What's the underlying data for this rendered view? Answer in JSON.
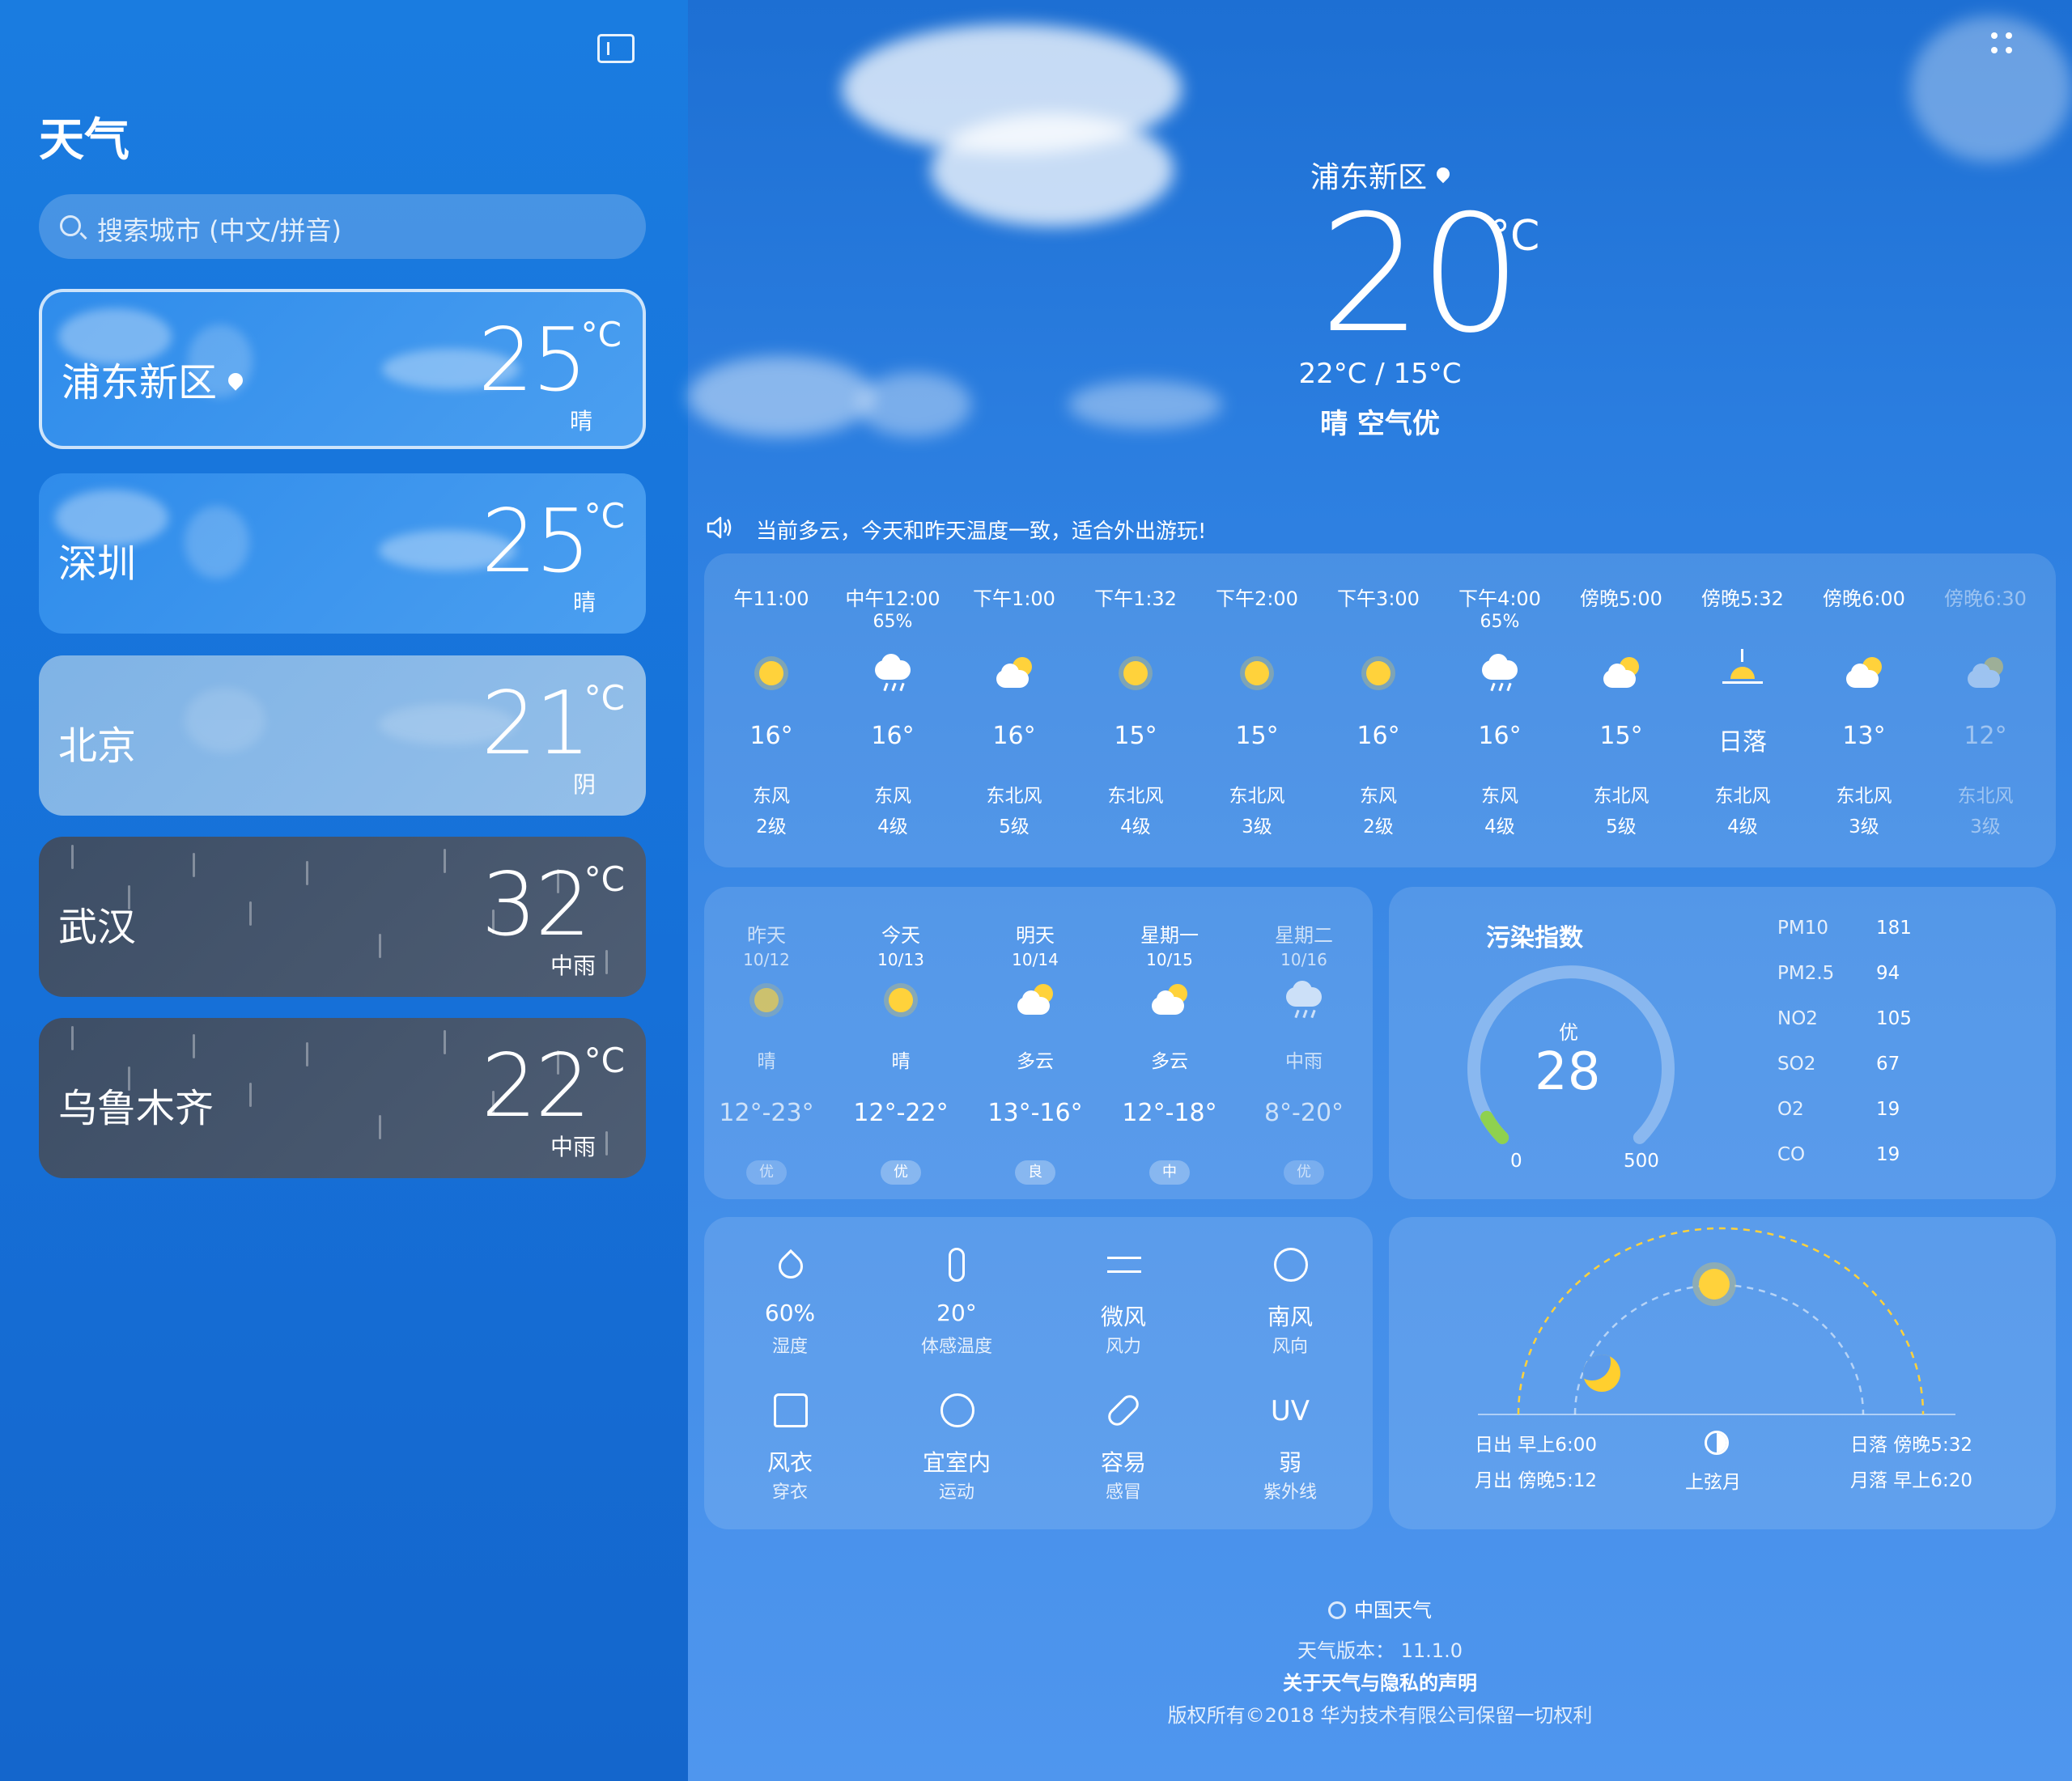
{
  "sidebar": {
    "title": "天气",
    "search_placeholder": "搜索城市 (中文/拼音)",
    "cities": [
      {
        "name": "浦东新区",
        "temp": "25",
        "unit": "°C",
        "condition": "晴",
        "located": true
      },
      {
        "name": "深圳",
        "temp": "25",
        "unit": "°C",
        "condition": "晴"
      },
      {
        "name": "北京",
        "temp": "21",
        "unit": "°C",
        "condition": "阴"
      },
      {
        "name": "武汉",
        "temp": "32",
        "unit": "°C",
        "condition": "中雨"
      },
      {
        "name": "乌鲁木齐",
        "temp": "22",
        "unit": "°C",
        "condition": "中雨"
      }
    ]
  },
  "current": {
    "location": "浦东新区",
    "temp": "20",
    "unit": "°C",
    "range": "22°C / 15°C",
    "condition": "晴 空气优",
    "broadcast": "当前多云，今天和昨天温度一致，适合外出游玩!"
  },
  "hourly": [
    {
      "time": "午11:00",
      "pop": "",
      "icon": "sun-icon",
      "temp": "16°",
      "wind": "东风",
      "level": "2级"
    },
    {
      "time": "中午12:00",
      "pop": "65%",
      "icon": "rain-cloud-icon",
      "temp": "16°",
      "wind": "东风",
      "level": "4级"
    },
    {
      "time": "下午1:00",
      "pop": "",
      "icon": "partly-cloudy-icon",
      "temp": "16°",
      "wind": "东北风",
      "level": "5级"
    },
    {
      "time": "下午1:32",
      "pop": "",
      "icon": "sun-icon",
      "temp": "15°",
      "wind": "东北风",
      "level": "4级"
    },
    {
      "time": "下午2:00",
      "pop": "",
      "icon": "sun-icon",
      "temp": "15°",
      "wind": "东北风",
      "level": "3级"
    },
    {
      "time": "下午3:00",
      "pop": "",
      "icon": "sun-icon",
      "temp": "16°",
      "wind": "东风",
      "level": "2级"
    },
    {
      "time": "下午4:00",
      "pop": "65%",
      "icon": "rain-cloud-icon",
      "temp": "16°",
      "wind": "东风",
      "level": "4级"
    },
    {
      "time": "傍晚5:00",
      "pop": "",
      "icon": "partly-cloudy-icon",
      "temp": "15°",
      "wind": "东北风",
      "level": "5级"
    },
    {
      "time": "傍晚5:32",
      "pop": "",
      "icon": "sunset-icon",
      "temp": "日落",
      "wind": "东北风",
      "level": "4级"
    },
    {
      "time": "傍晚6:00",
      "pop": "",
      "icon": "partly-cloudy-icon",
      "temp": "13°",
      "wind": "东北风",
      "level": "3级"
    },
    {
      "time": "傍晚6:30",
      "pop": "",
      "icon": "partly-cloudy-icon",
      "temp": "12°",
      "wind": "东北风",
      "level": "3级"
    }
  ],
  "daily": [
    {
      "name": "昨天",
      "date": "10/12",
      "icon": "sun-icon",
      "condition": "晴",
      "range": "12°-23°",
      "aqi": "优"
    },
    {
      "name": "今天",
      "date": "10/13",
      "icon": "sun-icon",
      "condition": "晴",
      "range": "12°-22°",
      "aqi": "优"
    },
    {
      "name": "明天",
      "date": "10/14",
      "icon": "partly-cloudy-icon",
      "condition": "多云",
      "range": "13°-16°",
      "aqi": "良"
    },
    {
      "name": "星期一",
      "date": "10/15",
      "icon": "partly-cloudy-icon",
      "condition": "多云",
      "range": "12°-18°",
      "aqi": "中"
    },
    {
      "name": "星期二",
      "date": "10/16",
      "icon": "rain-cloud-icon",
      "condition": "中雨",
      "range": "8°-20°",
      "aqi": "优"
    }
  ],
  "pollution": {
    "title": "污染指数",
    "level": "优",
    "value": "28",
    "fraction": 0.056,
    "min": "0",
    "max": "500",
    "items": [
      {
        "k": "PM10",
        "v": "181"
      },
      {
        "k": "PM2.5",
        "v": "94"
      },
      {
        "k": "NO2",
        "v": "105"
      },
      {
        "k": "SO2",
        "v": "67"
      },
      {
        "k": "O2",
        "v": "19"
      },
      {
        "k": "CO",
        "v": "19"
      }
    ]
  },
  "details": [
    {
      "icon": "humidity-icon",
      "value": "60%",
      "label": "湿度"
    },
    {
      "icon": "thermometer-icon",
      "value": "20°",
      "label": "体感温度"
    },
    {
      "icon": "wind-icon",
      "value": "微风",
      "label": "风力"
    },
    {
      "icon": "compass-icon",
      "value": "南风",
      "label": "风向"
    },
    {
      "icon": "shirt-icon",
      "value": "风衣",
      "label": "穿衣"
    },
    {
      "icon": "ball-icon",
      "value": "宜室内",
      "label": "运动"
    },
    {
      "icon": "pill-icon",
      "value": "容易",
      "label": "感冒"
    },
    {
      "icon": "uv-icon",
      "value": "弱",
      "label": "紫外线",
      "glyph": "UV"
    }
  ],
  "sunmoon": {
    "sunrise": "日出 早上6:00",
    "moonrise": "月出 傍晚5:12",
    "moon_phase": "上弦月",
    "sunset": "日落 傍晚5:32",
    "moonset": "月落 早上6:20"
  },
  "footer": {
    "brand": "中国天气",
    "version": "天气版本：  11.1.0",
    "privacy": "关于天气与隐私的声明",
    "copyright": "版权所有©2018 华为技术有限公司保留一切权利"
  }
}
